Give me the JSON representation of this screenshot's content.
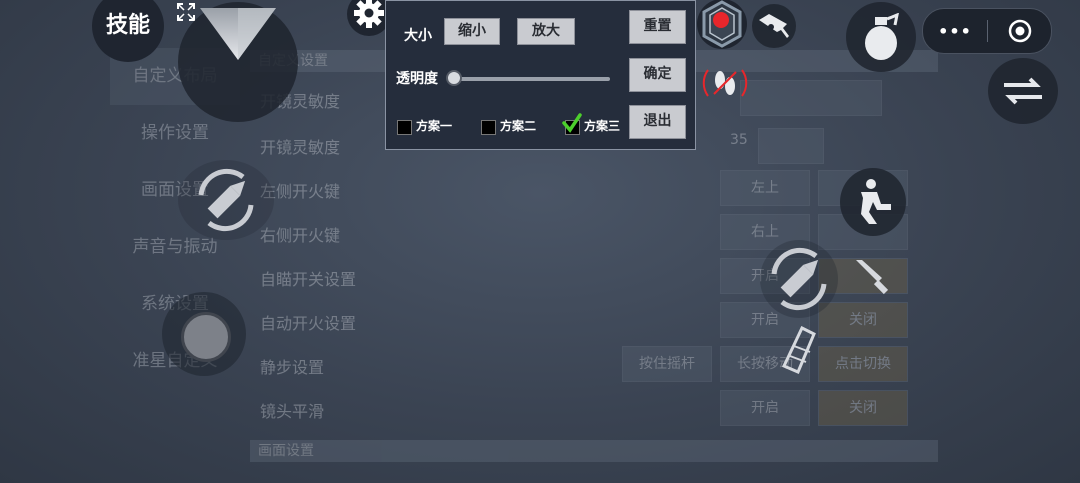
{
  "background_menu": {
    "sidebar": [
      "自定义布局",
      "操作设置",
      "画面设置",
      "声音与振动",
      "系统设置",
      "准星自定义"
    ],
    "section_top": "自定义设置",
    "rows": [
      {
        "label": "开镜灵敏度",
        "value": ""
      },
      {
        "label": "开镜灵敏度",
        "value": "35"
      },
      {
        "label": "左侧开火键",
        "buttons": [
          "左上",
          ""
        ]
      },
      {
        "label": "右侧开火键",
        "buttons": [
          "右上",
          ""
        ]
      },
      {
        "label": "自瞄开关设置",
        "buttons": [
          "开启",
          ""
        ]
      },
      {
        "label": "自动开火设置",
        "buttons": [
          "开启",
          "关闭"
        ]
      },
      {
        "label": "静步设置",
        "buttons": [
          "按住摇杆",
          "长按移动",
          "点击切换"
        ]
      },
      {
        "label": "镜头平滑",
        "buttons": [
          "开启",
          "关闭"
        ]
      }
    ],
    "section_bottom": "画面设置"
  },
  "hud": {
    "skill_label": "技能",
    "capsule_more": "•••"
  },
  "popup": {
    "size_label": "大小",
    "shrink_btn": "缩小",
    "enlarge_btn": "放大",
    "reset_btn": "重置",
    "opacity_label": "透明度",
    "opacity_value": 0.0,
    "confirm_btn": "确定",
    "exit_btn": "退出",
    "schemes": [
      {
        "label": "方案一",
        "checked": false
      },
      {
        "label": "方案二",
        "checked": false
      },
      {
        "label": "方案三",
        "checked": true
      }
    ]
  },
  "colors": {
    "popup_bg": "#252d3c",
    "record_red": "#e8262b",
    "check_green": "#4ccf2c"
  }
}
